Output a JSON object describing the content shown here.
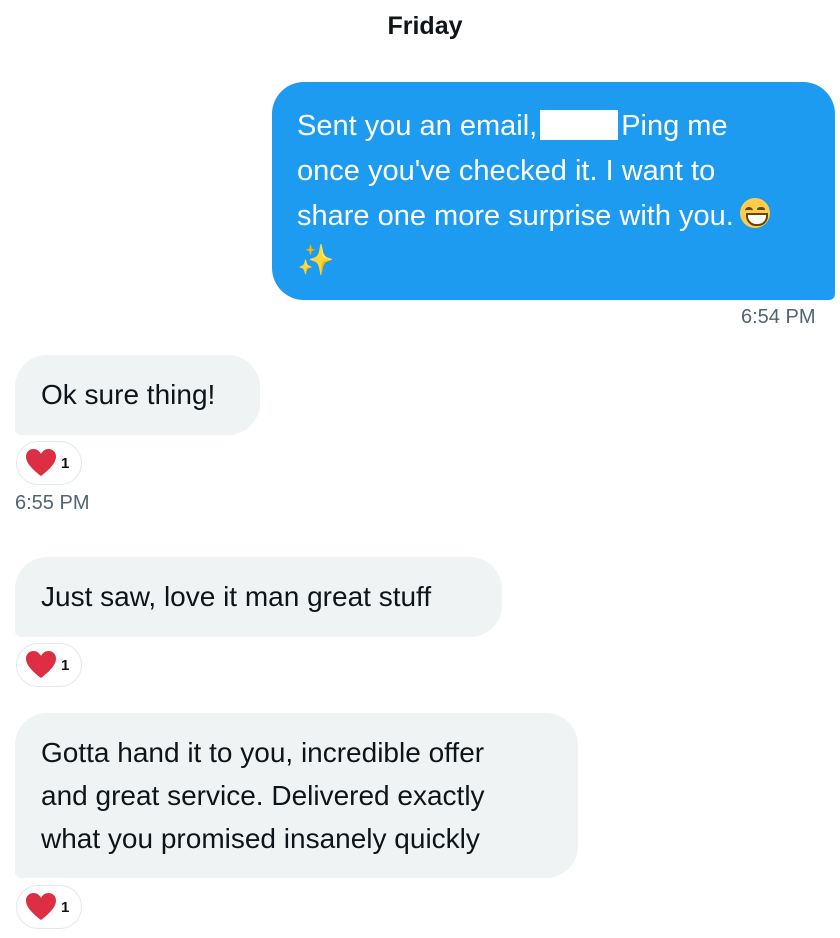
{
  "conversation": {
    "day_label": "Friday",
    "messages": [
      {
        "direction": "outgoing",
        "line1_a": "Sent you an email,",
        "line1_b": "Ping me",
        "line2": "once you've checked it. I want to",
        "line3": "share one more surprise with you.",
        "emoji_1": "grinning-face",
        "emoji_2": "sparkles",
        "time": "6:54 PM"
      },
      {
        "direction": "incoming",
        "text": "Ok sure thing!",
        "reaction": {
          "icon": "heart-icon",
          "count": "1"
        },
        "time": "6:55 PM"
      },
      {
        "direction": "incoming",
        "text": "Just saw, love it man great stuff",
        "reaction": {
          "icon": "heart-icon",
          "count": "1"
        }
      },
      {
        "direction": "incoming",
        "lines": [
          "Gotta hand it to you, incredible offer",
          "and great service. Delivered exactly",
          "what you promised insanely quickly"
        ],
        "reaction": {
          "icon": "heart-icon",
          "count": "1"
        }
      }
    ]
  },
  "colors": {
    "outgoing_bubble": "#1d9bf0",
    "incoming_bubble": "#eff3f4",
    "heart": "#e0245e",
    "timestamp": "#536471"
  }
}
